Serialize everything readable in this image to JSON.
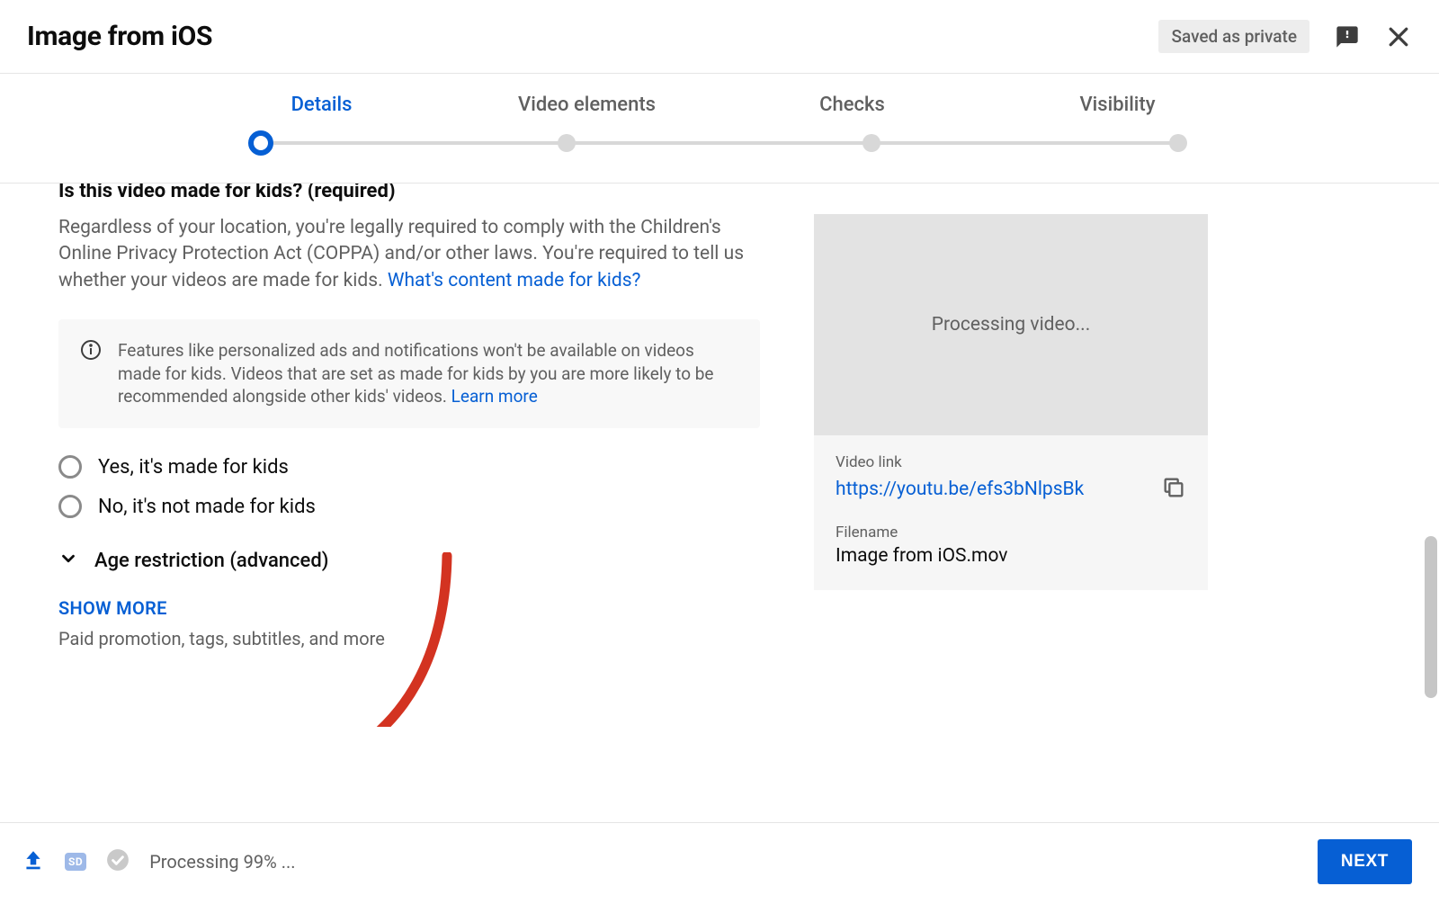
{
  "header": {
    "title": "Image from iOS",
    "saved_chip": "Saved as private"
  },
  "stepper": {
    "steps": [
      "Details",
      "Video elements",
      "Checks",
      "Visibility"
    ],
    "active_index": 0
  },
  "kids_section": {
    "heading": "Is this video made for kids? (required)",
    "description": "Regardless of your location, you're legally required to comply with the Children's Online Privacy Protection Act (COPPA) and/or other laws. You're required to tell us whether your videos are made for kids. ",
    "description_link": "What's content made for kids?",
    "info_text": "Features like personalized ads and notifications won't be available on videos made for kids. Videos that are set as made for kids by you are more likely to be recommended alongside other kids' videos. ",
    "info_link": "Learn more",
    "radio_yes": "Yes, it's made for kids",
    "radio_no": "No, it's not made for kids",
    "age_restriction": "Age restriction (advanced)"
  },
  "show_more": {
    "label": "SHOW MORE",
    "description": "Paid promotion, tags, subtitles, and more"
  },
  "preview": {
    "processing": "Processing video...",
    "video_link_label": "Video link",
    "video_link": "https://youtu.be/efs3bNlpsBk",
    "filename_label": "Filename",
    "filename": "Image from iOS.mov"
  },
  "footer": {
    "sd_badge": "SD",
    "status": "Processing 99% ...",
    "next": "NEXT"
  }
}
